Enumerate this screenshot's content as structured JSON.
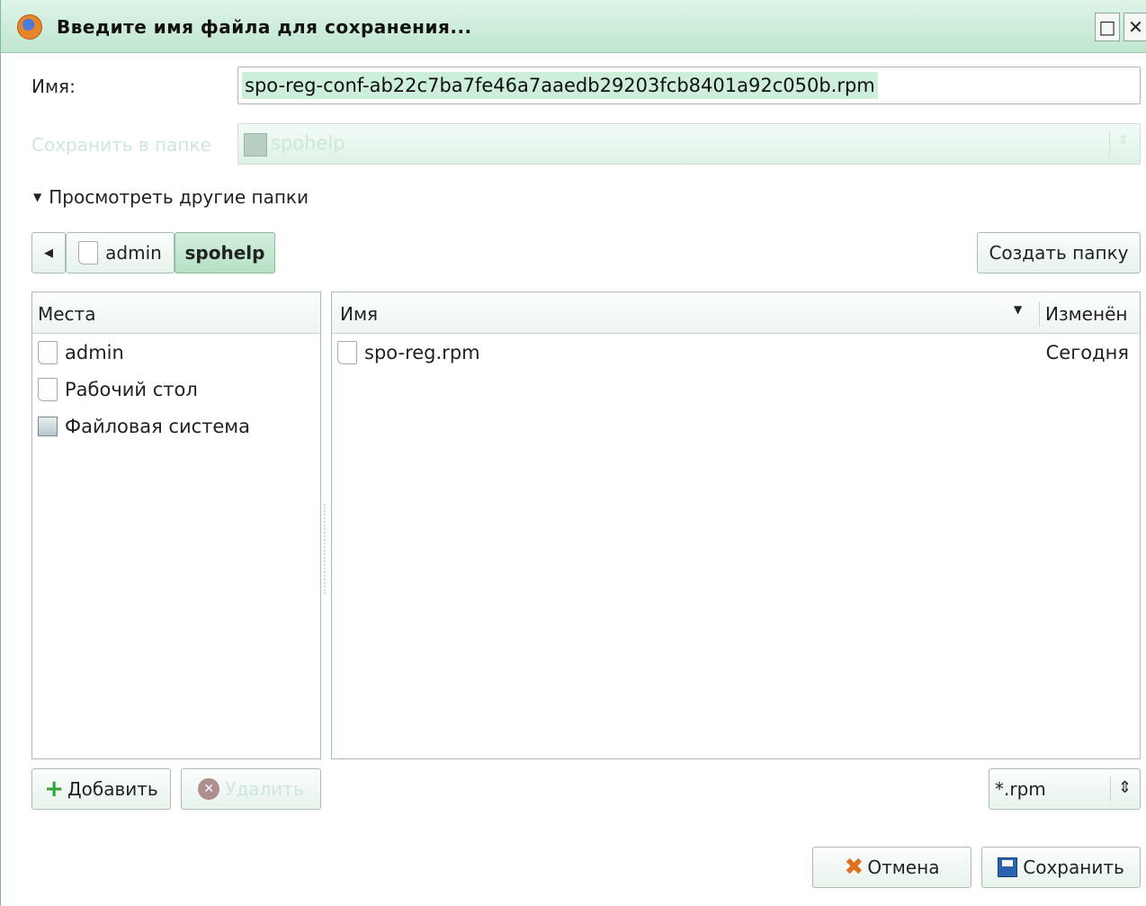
{
  "window": {
    "title": "Введите имя файла для сохранения..."
  },
  "name_field": {
    "label": "Имя:",
    "value": "spo-reg-conf-ab22c7ba7fe46a7aaedb29203fcb8401a92c050b.rpm"
  },
  "save_in": {
    "label": "Сохранить в папке",
    "value": "spohelp"
  },
  "expander": {
    "label": "Просмотреть другие папки"
  },
  "path_bar": {
    "crumbs": [
      "admin",
      "spohelp"
    ]
  },
  "create_folder_label": "Создать папку",
  "places": {
    "header": "Места",
    "items": [
      "admin",
      "Рабочий стол",
      "Файловая система"
    ]
  },
  "files": {
    "headers": {
      "name": "Имя",
      "modified": "Изменён"
    },
    "rows": [
      {
        "name": "spo-reg.rpm",
        "modified": "Сегодня"
      }
    ]
  },
  "buttons": {
    "add": "Добавить",
    "remove": "Удалить",
    "cancel": "Отмена",
    "save": "Сохранить"
  },
  "filter": {
    "value": "*.rpm"
  },
  "icons": [
    "app-icon",
    "maximize-icon",
    "close-icon",
    "folder-icon",
    "back-arrow-icon",
    "document-icon",
    "filesystem-icon",
    "plus-icon",
    "remove-icon",
    "cancel-icon",
    "floppy-icon"
  ]
}
